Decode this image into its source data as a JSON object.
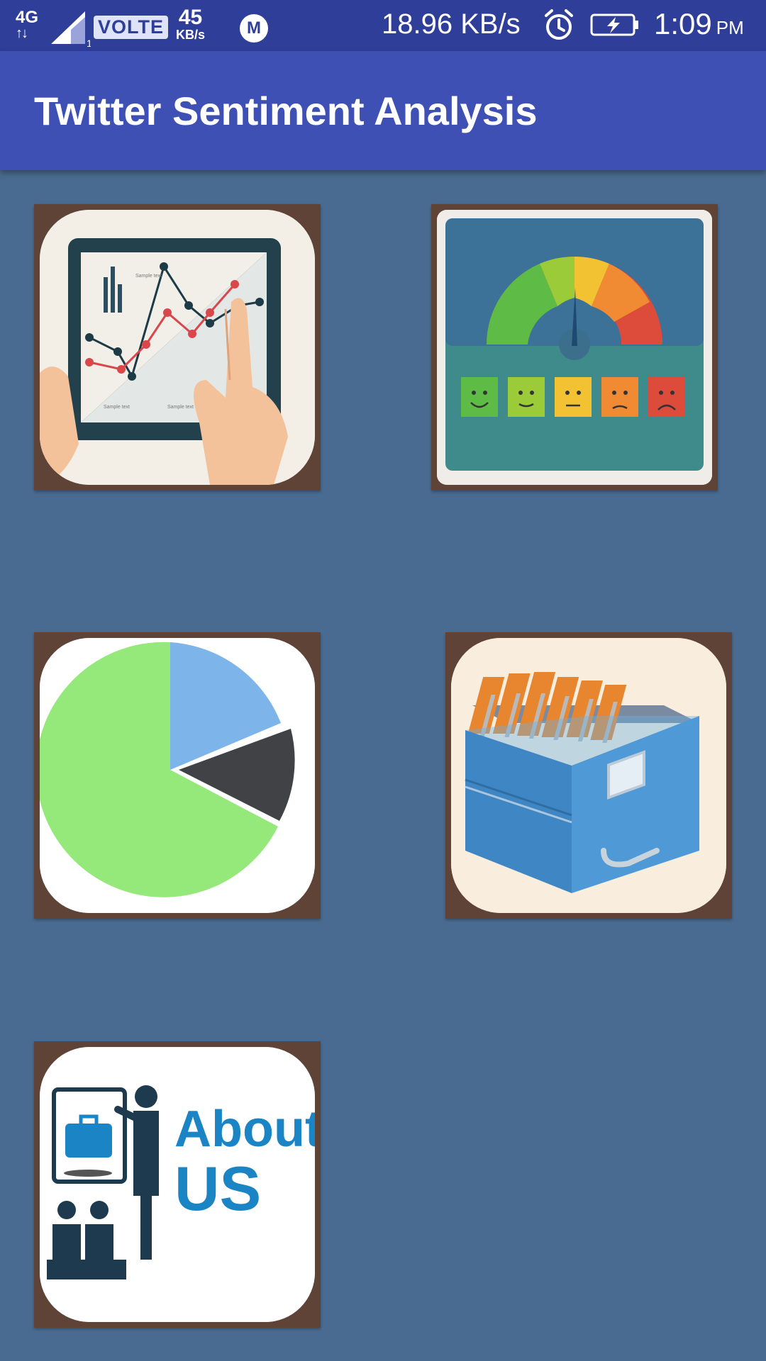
{
  "status_bar": {
    "network": "4G",
    "sim_slot": "1",
    "volte": "VOLTE",
    "data_speed_value": "45",
    "data_speed_unit": "KB/s",
    "notification_icon": "M",
    "transfer_rate": "18.96 KB/s",
    "time": "1:09",
    "ampm": "PM"
  },
  "app_bar": {
    "title": "Twitter Sentiment Analysis"
  },
  "tiles": [
    {
      "id": "analytics",
      "icon": "tablet-chart-icon",
      "texts": [
        "Sample text",
        "Sample text",
        "Sample text"
      ]
    },
    {
      "id": "sentiment",
      "icon": "sentiment-gauge-icon"
    },
    {
      "id": "pie",
      "icon": "pie-chart-icon"
    },
    {
      "id": "records",
      "icon": "file-cabinet-icon"
    },
    {
      "id": "about",
      "icon": "about-us-icon",
      "label_line1": "About",
      "label_line2": "US"
    }
  ],
  "colors": {
    "status_bar": "#2f3e99",
    "app_bar": "#3e50b4",
    "background": "#4a6b91",
    "tile_border": "#5e4336"
  }
}
